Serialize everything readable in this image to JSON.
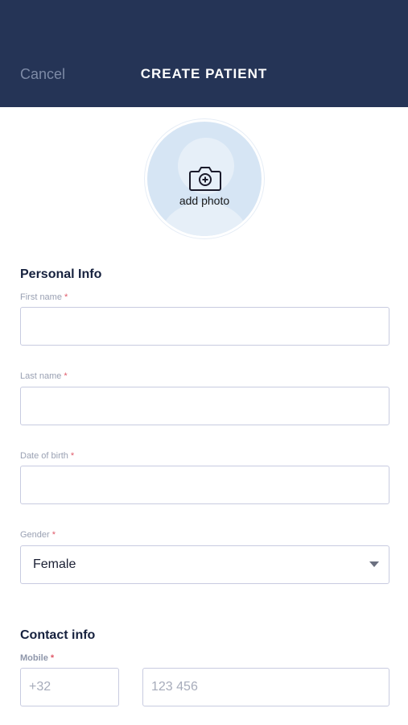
{
  "header": {
    "cancel_label": "Cancel",
    "title": "CREATE PATIENT"
  },
  "photo": {
    "label": "add photo"
  },
  "personal_info": {
    "heading": "Personal Info",
    "first_name_label": "First name",
    "last_name_label": "Last name",
    "dob_label": "Date of birth",
    "gender_label": "Gender",
    "gender_value": "Female",
    "required_marker": "*"
  },
  "contact_info": {
    "heading": "Contact info",
    "mobile_label": "Mobile",
    "country_code_placeholder": "+32",
    "number_placeholder": "123 456"
  },
  "colors": {
    "header_bg": "#253456",
    "accent": "#e05a6a"
  }
}
